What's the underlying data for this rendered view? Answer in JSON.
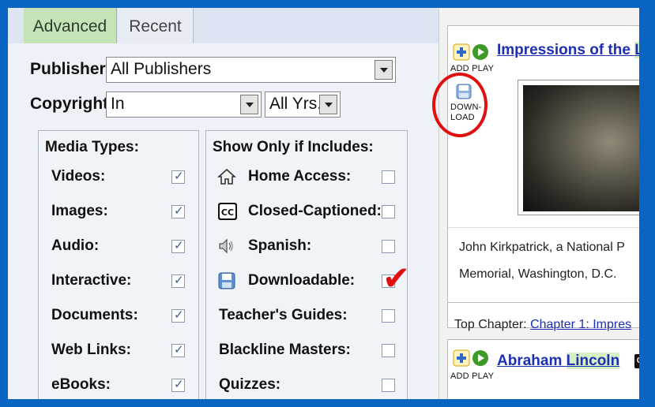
{
  "tabs": [
    {
      "label": "Advanced"
    },
    {
      "label": "Recent"
    }
  ],
  "filters": {
    "publisher_label": "Publisher:",
    "publisher_value": "All Publishers",
    "copyright_label": "Copyright:",
    "copyright_value": "In",
    "years_value": "All Yrs."
  },
  "media_types": {
    "title": "Media Types:",
    "items": [
      {
        "label": "Videos:",
        "checked": true
      },
      {
        "label": "Images:",
        "checked": true
      },
      {
        "label": "Audio:",
        "checked": true
      },
      {
        "label": "Interactive:",
        "checked": true
      },
      {
        "label": "Documents:",
        "checked": true
      },
      {
        "label": "Web Links:",
        "checked": true
      },
      {
        "label": "eBooks:",
        "checked": true
      }
    ]
  },
  "show_only": {
    "title": "Show Only if Includes:",
    "items": [
      {
        "label": "Home Access:",
        "icon": "home-icon",
        "checked": false
      },
      {
        "label": "Closed-Captioned:",
        "icon": "cc-icon",
        "checked": false
      },
      {
        "label": "Spanish:",
        "icon": "speaker-icon",
        "checked": false
      },
      {
        "label": "Downloadable:",
        "icon": "floppy-icon",
        "checked": false
      },
      {
        "label": "Teacher's Guides:",
        "checked": false
      },
      {
        "label": "Blackline Masters:",
        "checked": false
      },
      {
        "label": "Quizzes:",
        "checked": false
      }
    ]
  },
  "results": [
    {
      "title_pre": "Impressions of the ",
      "title_hl": "Li",
      "add_play_label": "ADD PLAY",
      "download_label_1": "DOWN-",
      "download_label_2": "LOAD",
      "desc_line1": "John Kirkpatrick, a National P",
      "desc_line2": "Memorial, Washington, D.C.",
      "chapter_label": "Top Chapter:",
      "chapter_link": "Chapter 1: Impres"
    },
    {
      "title_pre": "Abraham ",
      "title_hl": "Lincoln",
      "add_play_label": "ADD PLAY",
      "cc_badge": "CC"
    }
  ],
  "annotation": {
    "check_mark": "✔"
  },
  "colors": {
    "border_blue": "#0a64c2",
    "active_tab": "#c4e3b7",
    "link_blue": "#1d2fb5",
    "highlight_green": "#d6f0c2",
    "annotation_red": "#e01010"
  }
}
